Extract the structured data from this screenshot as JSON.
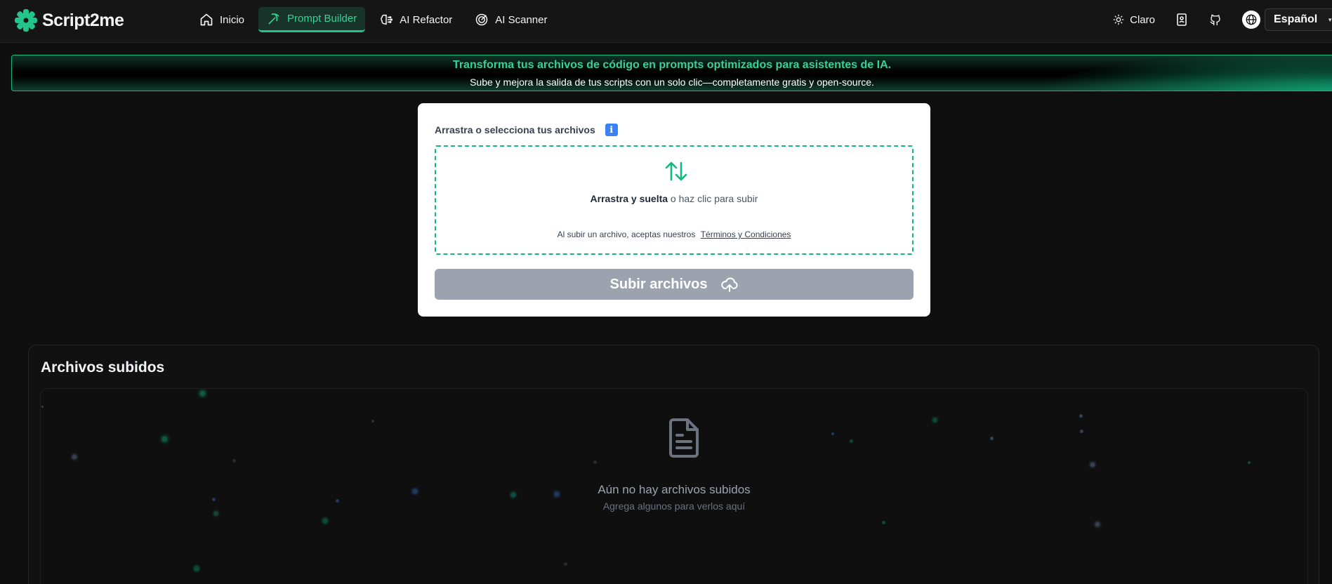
{
  "header": {
    "brand": "Script2me",
    "nav": [
      {
        "label": "Inicio",
        "icon": "home-icon"
      },
      {
        "label": "Prompt Builder",
        "icon": "pickaxe-icon",
        "active": true
      },
      {
        "label": "AI Refactor",
        "icon": "brain-icon"
      },
      {
        "label": "AI Scanner",
        "icon": "radar-icon"
      }
    ],
    "theme_label": "Claro",
    "language": "Español"
  },
  "banner": {
    "title": "Transforma tus archivos de código en prompts optimizados para asistentes de IA.",
    "subtitle": "Sube y mejora la salida de tus scripts con un solo clic—completamente gratis y open-source."
  },
  "upload": {
    "label": "Arrastra o selecciona tus archivos",
    "drop_bold": "Arrastra y suelta",
    "drop_rest": " o haz clic para subir",
    "terms_prefix": "Al subir un archivo, aceptas nuestros",
    "terms_link": "Términos y Condiciones",
    "button": "Subir archivos"
  },
  "files": {
    "title": "Archivos subidos",
    "empty_title": "Aún no hay archivos subidos",
    "empty_subtitle": "Agrega algunos para verlos aquí"
  },
  "colors": {
    "accent": "#10b981",
    "accent_text": "#34d399",
    "background": "#0f0f0f",
    "button_disabled": "#9ca3af",
    "info": "#3b82f6"
  }
}
